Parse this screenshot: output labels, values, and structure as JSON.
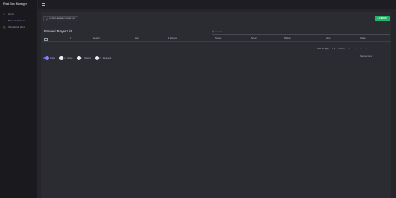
{
  "app": {
    "title": "Rust Ban Manager"
  },
  "sidebar": {
    "items": [
      {
        "label": "Home",
        "icon": "home-icon",
        "glyph": "⌂"
      },
      {
        "label": "Banned Players",
        "icon": "code-icon",
        "glyph": "‹›"
      },
      {
        "label": "Scheduled bans",
        "icon": "clock-icon",
        "glyph": "◷"
      }
    ]
  },
  "toolbar": {
    "extend_label": "EXTEND BANNED PLAYER LIST",
    "create_label": "CREATE",
    "create_color": "#21b36a"
  },
  "list": {
    "title": "Banned Player List",
    "search_placeholder": "Search",
    "columns": [
      "Id",
      "SteamId",
      "Name",
      "IP address",
      "Source",
      "Server",
      "Platform",
      "Admin",
      "Status"
    ]
  },
  "pagination": {
    "rows_label": "Rows per page",
    "rows_value": "10",
    "range_label": "0-0 of 0"
  },
  "filters": [
    {
      "label": "Active",
      "on": true
    },
    {
      "label": "Online",
      "on": false
    },
    {
      "label": "Deleted",
      "on": false
    },
    {
      "label": "Reviewed",
      "on": false
    }
  ],
  "selection": {
    "label": "Selected Items:"
  }
}
